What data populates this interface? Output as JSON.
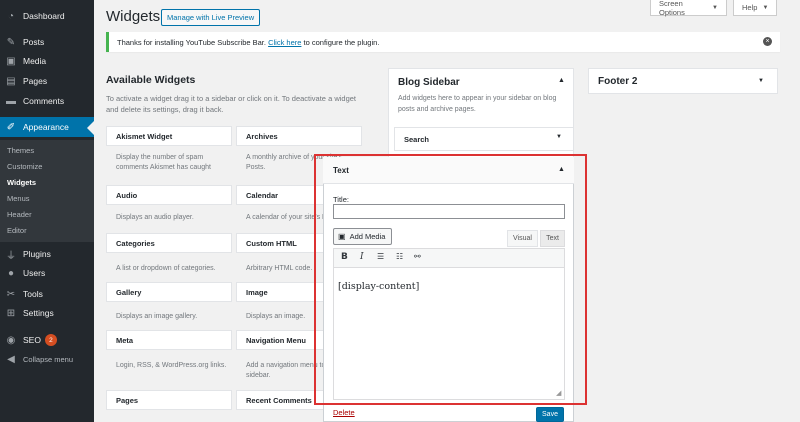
{
  "admin_menu": {
    "dashboard": "Dashboard",
    "posts": "Posts",
    "media": "Media",
    "pages": "Pages",
    "comments": "Comments",
    "appearance": "Appearance",
    "submenu": [
      "Themes",
      "Customize",
      "Widgets",
      "Menus",
      "Header",
      "Editor"
    ],
    "plugins": "Plugins",
    "users": "Users",
    "tools": "Tools",
    "settings": "Settings",
    "seo": "SEO",
    "seo_badge": "2",
    "collapse": "Collapse menu"
  },
  "top_buttons": {
    "screen_options": "Screen Options",
    "help": "Help"
  },
  "page": {
    "title": "Widgets",
    "live_preview": "Manage with Live Preview"
  },
  "notice": {
    "before": "Thanks for installing YouTube Subscribe Bar.",
    "link": "Click here",
    "after": "to configure the plugin."
  },
  "available": {
    "title": "Available Widgets",
    "description": "To activate a widget drag it to a sidebar or click on it. To deactivate a widget and delete its settings, drag it back.",
    "widgets": [
      {
        "name": "Akismet Widget",
        "desc": "Display the number of spam comments Akismet has caught"
      },
      {
        "name": "Archives",
        "desc": "A monthly archive of your site's Posts."
      },
      {
        "name": "Audio",
        "desc": "Displays an audio player."
      },
      {
        "name": "Calendar",
        "desc": "A calendar of your site's Posts."
      },
      {
        "name": "Categories",
        "desc": "A list or dropdown of categories."
      },
      {
        "name": "Custom HTML",
        "desc": "Arbitrary HTML code."
      },
      {
        "name": "Gallery",
        "desc": "Displays an image gallery."
      },
      {
        "name": "Image",
        "desc": "Displays an image."
      },
      {
        "name": "Meta",
        "desc": "Login, RSS, & WordPress.org links."
      },
      {
        "name": "Navigation Menu",
        "desc": "Add a navigation menu to your sidebar."
      },
      {
        "name": "Pages",
        "desc": ""
      },
      {
        "name": "Recent Comments",
        "desc": ""
      }
    ]
  },
  "blog_sidebar": {
    "title": "Blog Sidebar",
    "description": "Add widgets here to appear in your sidebar on blog posts and archive pages.",
    "search": "Search"
  },
  "footer2": {
    "title": "Footer 2"
  },
  "text_widget": {
    "title": "Text",
    "field_label": "Title:",
    "title_value": "",
    "add_media": "Add Media",
    "tab_visual": "Visual",
    "tab_text": "Text",
    "content": "[display-content]",
    "delete": "Delete",
    "save": "Save"
  },
  "colors": {
    "accent": "#0073aa",
    "highlight": "#dc3232",
    "notice": "#46b450",
    "sidebar": "#23282d"
  }
}
